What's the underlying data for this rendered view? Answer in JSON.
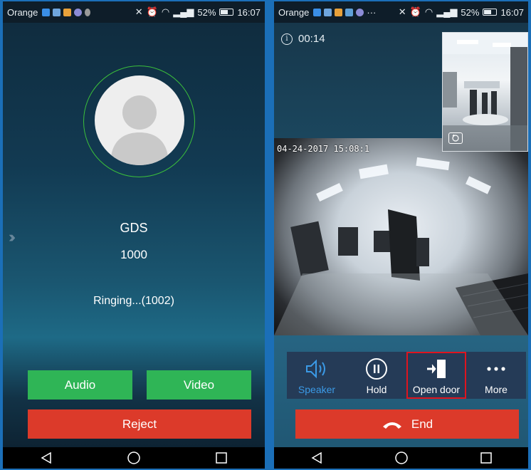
{
  "left_screen": {
    "status_bar": {
      "carrier": "Orange",
      "battery": "52%",
      "time": "16:07"
    },
    "caller_name": "GDS",
    "caller_number": "1000",
    "call_status": "Ringing...(1002)",
    "buttons": {
      "audio": "Audio",
      "video": "Video",
      "reject": "Reject"
    }
  },
  "right_screen": {
    "status_bar": {
      "carrier": "Orange",
      "battery": "52%",
      "time": "16:07"
    },
    "call_timer": "00:14",
    "video_timestamp": "04-24-2017 15:08:1",
    "controls": [
      {
        "label": "Speaker",
        "icon": "speaker-icon",
        "active": true
      },
      {
        "label": "Hold",
        "icon": "pause-icon"
      },
      {
        "label": "Open door",
        "icon": "open-door-icon",
        "highlighted": true
      },
      {
        "label": "More",
        "icon": "more-dots-icon"
      }
    ],
    "end_label": "End"
  },
  "colors": {
    "accept_green": "#2fb556",
    "reject_red": "#dc3a2a",
    "active_blue": "#3b9ae6",
    "highlight_red": "#e0141e",
    "avatar_ring": "#3bbf3b"
  }
}
